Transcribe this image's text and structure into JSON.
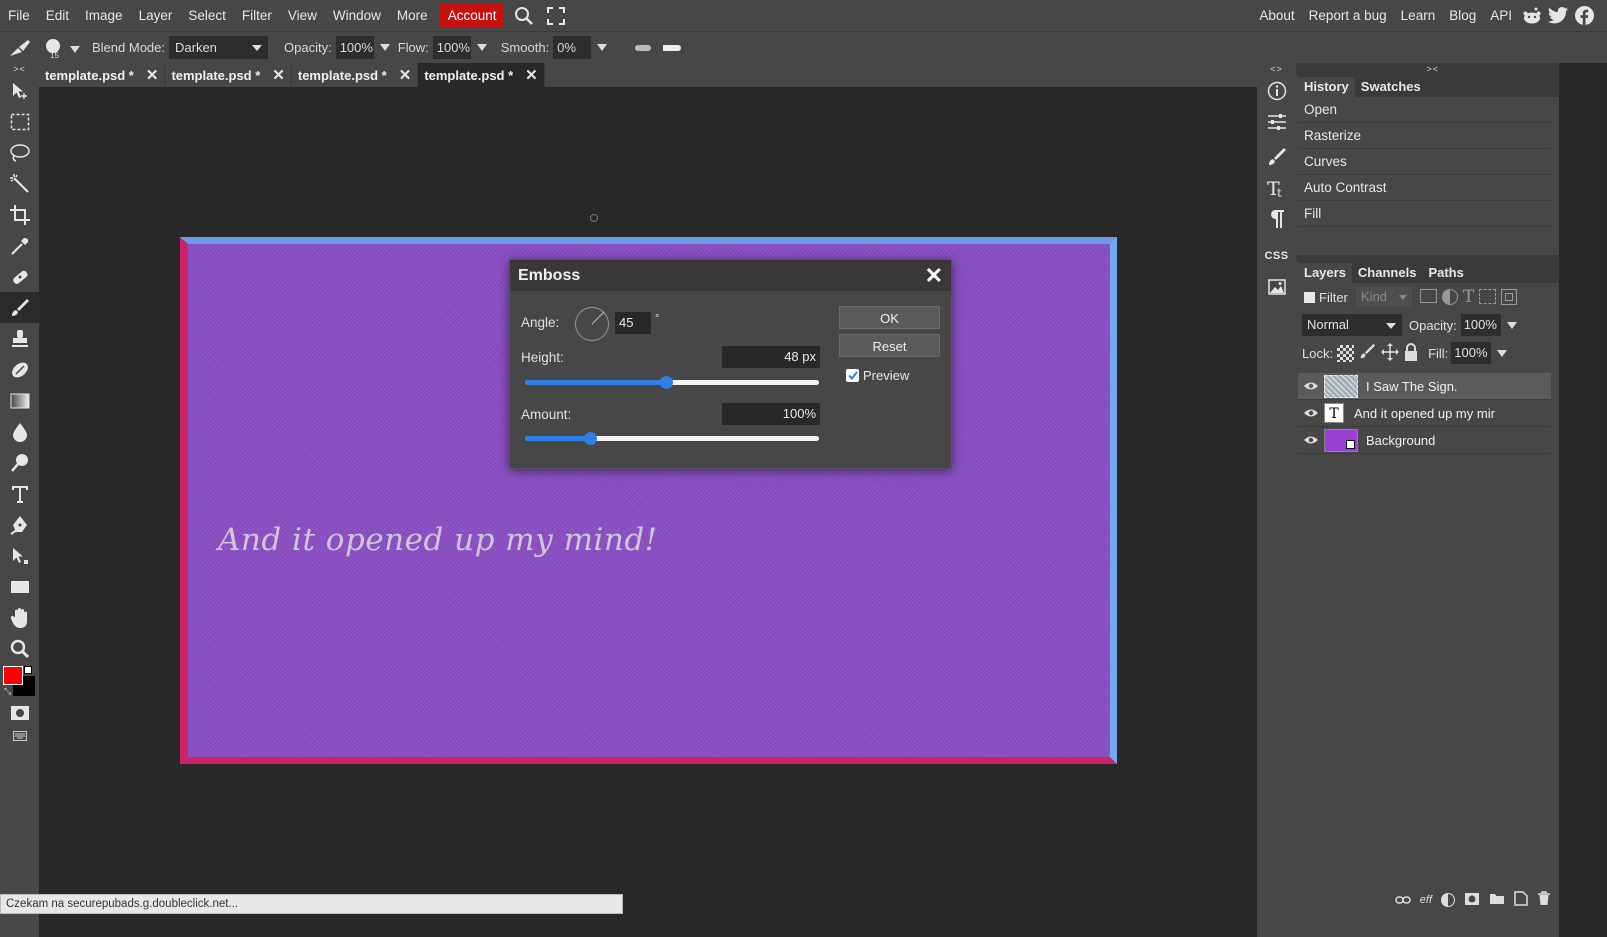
{
  "menu": {
    "items": [
      "File",
      "Edit",
      "Image",
      "Layer",
      "Select",
      "Filter",
      "View",
      "Window",
      "More"
    ],
    "account": "Account",
    "right_items": [
      "About",
      "Report a bug",
      "Learn",
      "Blog",
      "API"
    ]
  },
  "options": {
    "brush_size": "15",
    "blend_mode_label": "Blend Mode:",
    "blend_mode_value": "Darken",
    "opacity_label": "Opacity:",
    "opacity_value": "100%",
    "flow_label": "Flow:",
    "flow_value": "100%",
    "smooth_label": "Smooth:",
    "smooth_value": "0%"
  },
  "tabs": [
    {
      "name": "template.psd *"
    },
    {
      "name": "template.psd *"
    },
    {
      "name": "template.psd *"
    },
    {
      "name": "template.psd *"
    }
  ],
  "canvas": {
    "text": "And it opened up my mind!"
  },
  "dialog": {
    "title": "Emboss",
    "angle_label": "Angle:",
    "angle_value": "45",
    "degree": "°",
    "height_label": "Height:",
    "height_value": "48 px",
    "height_fraction": 0.48,
    "amount_label": "Amount:",
    "amount_value": "100%",
    "amount_fraction": 0.22,
    "ok": "OK",
    "reset": "Reset",
    "preview_label": "Preview",
    "preview_checked": true
  },
  "history": {
    "tabs": [
      "History",
      "Swatches"
    ],
    "items": [
      "Open",
      "Rasterize",
      "Curves",
      "Auto Contrast",
      "Fill"
    ]
  },
  "layers": {
    "tabs": [
      "Layers",
      "Channels",
      "Paths"
    ],
    "filter_label": "Filter",
    "kind_placeholder": "Kind",
    "blend_value": "Normal",
    "opacity_label": "Opacity:",
    "opacity_value": "100%",
    "lock_label": "Lock:",
    "fill_label": "Fill:",
    "fill_value": "100%",
    "items": [
      {
        "name": "I Saw The Sign."
      },
      {
        "name": "And it opened up my mir"
      },
      {
        "name": "Background"
      }
    ]
  },
  "status": {
    "text": "Czekam na securepubads.g.doubleclick.net..."
  },
  "colors": {
    "foreground": "#ff0000",
    "background": "#000000",
    "accent": "#2f7fe6",
    "account": "#c41010"
  }
}
